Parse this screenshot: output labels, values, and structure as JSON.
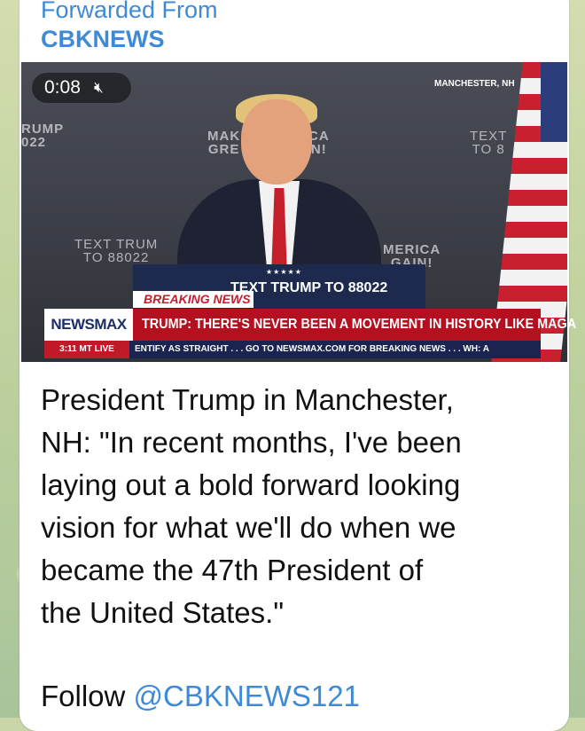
{
  "forward": {
    "title": "Forwarded From",
    "source": "CBKNEWS"
  },
  "video": {
    "duration": "0:08",
    "mute_icon": "speaker-muted-icon",
    "mute_glyph": "🔇︎",
    "location": "MANCHESTER, NH",
    "backdrop": {
      "left_top": "RUMP\n022",
      "left_mid": "TEXT TRUM\nTO 88022",
      "center_a": "MAK\nGRE",
      "center_b": "CA\nN!",
      "right_top": "TEXT\nTO 8",
      "right_mid": "MERICA\nGAIN!"
    },
    "podium_stars": "★★★★★",
    "podium_text": "TEXT TRUMP TO 88022",
    "breaking_label": "BREAKING NEWS",
    "channel_logo": "NEWSMAX",
    "headline": "TRUMP: THERE'S NEVER BEEN A MOVEMENT IN HISTORY LIKE MAGA",
    "clock": "3:11 MT   LIVE",
    "crawl": "ENTIFY AS STRAIGHT . . .     GO TO NEWSMAX.COM FOR BREAKING NEWS . . .     WH: A"
  },
  "message": {
    "caption": "President Trump in Manchester,\nNH: \"In recent months, I've been\nlaying out a bold forward looking\nvision for what we'll do when we\nbecame the 47th President of\nthe United States.\"",
    "follow_label": "Follow ",
    "follow_handle": "@CBKNEWS121"
  },
  "colors": {
    "link": "#3e8ad6",
    "newsmax_red": "#b5101f",
    "newsmax_navy": "#1b2350"
  }
}
